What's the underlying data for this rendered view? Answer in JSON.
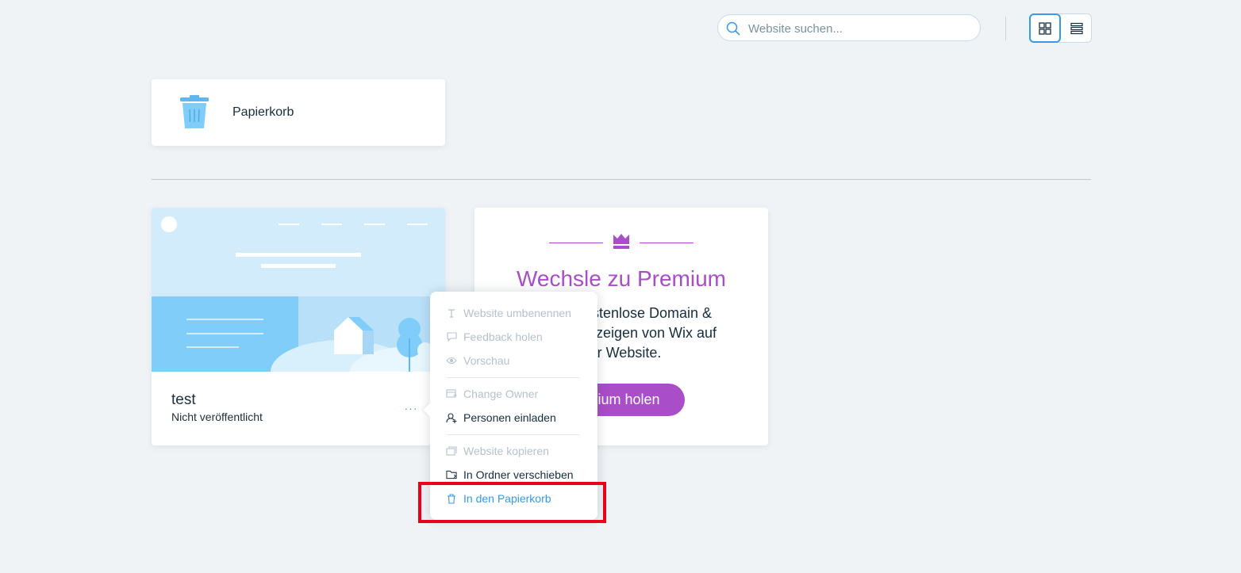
{
  "search": {
    "placeholder": "Website suchen..."
  },
  "trash": {
    "label": "Papierkorb"
  },
  "site": {
    "name": "test",
    "status": "Nicht veröffentlicht",
    "more_label": "···"
  },
  "premium": {
    "title": "Wechsle zu Premium",
    "text_lines": [
      "kostenlose Domain &",
      "eanzeigen von Wix auf",
      "er Website."
    ],
    "button_label": "mium holen"
  },
  "menu": {
    "items": [
      {
        "label": "Website umbenennen",
        "state": "disabled",
        "icon": "text-icon"
      },
      {
        "label": "Feedback holen",
        "state": "disabled",
        "icon": "comment-icon"
      },
      {
        "label": "Vorschau",
        "state": "disabled",
        "icon": "eye-icon"
      },
      {
        "label": "Change Owner",
        "state": "disabled",
        "icon": "transfer-icon"
      },
      {
        "label": "Personen einladen",
        "state": "enabled",
        "icon": "invite-user-icon"
      },
      {
        "label": "Website kopieren",
        "state": "disabled",
        "icon": "duplicate-icon"
      },
      {
        "label": "In Ordner verschieben",
        "state": "enabled",
        "icon": "folder-icon"
      },
      {
        "label": "In den Papierkorb",
        "state": "active",
        "icon": "trash-icon"
      }
    ]
  },
  "colors": {
    "accent": "#3899ec",
    "premium": "#aa4dc8",
    "highlight": "#e8001c",
    "background": "#eff3f6"
  }
}
